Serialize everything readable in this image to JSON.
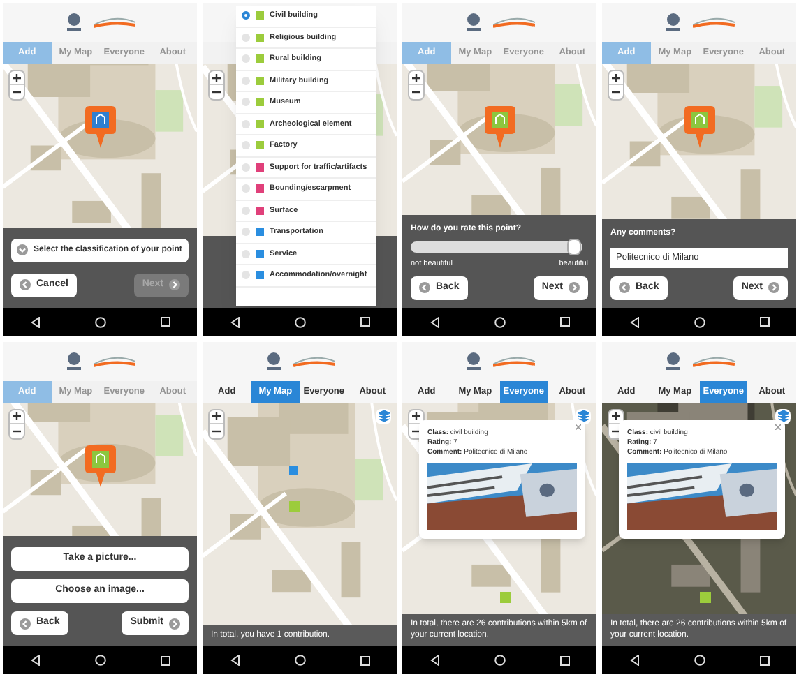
{
  "phones": [
    {
      "tabs_disabled": true,
      "tabs": [
        {
          "label": "Add",
          "selected": true
        },
        {
          "label": "My Map",
          "selected": false
        },
        {
          "label": "Everyone",
          "selected": false
        },
        {
          "label": "About",
          "selected": false
        }
      ],
      "map": {
        "kind": "street",
        "layers": false,
        "marker": {
          "kind": "pin",
          "color": "#2f7fd0"
        }
      },
      "panel": {
        "kind": "classification",
        "select": "Select the classification of your point",
        "buttons": [
          {
            "label": "Cancel",
            "kind": "back",
            "disabled": false
          },
          {
            "label": "Next",
            "kind": "forward",
            "disabled": true
          }
        ]
      }
    },
    {
      "tabs_disabled": true,
      "map": {
        "kind": "street",
        "layers": false
      },
      "panel": {
        "kind": "blank"
      },
      "dropdown": {
        "items": [
          {
            "label": "Civil building",
            "selected": true,
            "color": "#9ccc3c"
          },
          {
            "label": "Religious building",
            "selected": false,
            "color": "#9ccc3c"
          },
          {
            "label": "Rural building",
            "selected": false,
            "color": "#9ccc3c"
          },
          {
            "label": "Military building",
            "selected": false,
            "color": "#9ccc3c"
          },
          {
            "label": "Museum",
            "selected": false,
            "color": "#9ccc3c"
          },
          {
            "label": "Archeological element",
            "selected": false,
            "color": "#9ccc3c"
          },
          {
            "label": "Factory",
            "selected": false,
            "color": "#9ccc3c"
          },
          {
            "label": "Support for traffic/artifacts",
            "selected": false,
            "color": "#e0407a"
          },
          {
            "label": "Bounding/escarpment",
            "selected": false,
            "color": "#e0407a"
          },
          {
            "label": "Surface",
            "selected": false,
            "color": "#e0407a"
          },
          {
            "label": "Transportation",
            "selected": false,
            "color": "#2a8ee0"
          },
          {
            "label": "Service",
            "selected": false,
            "color": "#2a8ee0"
          },
          {
            "label": "Accommodation/overnight",
            "selected": false,
            "color": "#2a8ee0"
          }
        ]
      }
    },
    {
      "tabs_disabled": true,
      "tabs": [
        {
          "label": "Add",
          "selected": true
        },
        {
          "label": "My Map",
          "selected": false
        },
        {
          "label": "Everyone",
          "selected": false
        },
        {
          "label": "About",
          "selected": false
        }
      ],
      "map": {
        "kind": "street",
        "layers": false,
        "marker": {
          "kind": "pin",
          "color": "#8cc63f"
        }
      },
      "panel": {
        "kind": "rating",
        "question": "How do you rate this point?",
        "level": 0.95,
        "low": "not beautiful",
        "high": "beautiful",
        "buttons": [
          {
            "label": "Back",
            "kind": "back",
            "disabled": false
          },
          {
            "label": "Next",
            "kind": "forward",
            "disabled": false
          }
        ]
      }
    },
    {
      "tabs_disabled": true,
      "tabs": [
        {
          "label": "Add",
          "selected": true
        },
        {
          "label": "My Map",
          "selected": false
        },
        {
          "label": "Everyone",
          "selected": false
        },
        {
          "label": "About",
          "selected": false
        }
      ],
      "map": {
        "kind": "street",
        "layers": false,
        "marker": {
          "kind": "pin",
          "color": "#8cc63f"
        }
      },
      "panel": {
        "kind": "comment",
        "question": "Any comments?",
        "value": "Politecnico di Milano",
        "buttons": [
          {
            "label": "Back",
            "kind": "back",
            "disabled": false
          },
          {
            "label": "Next",
            "kind": "forward",
            "disabled": false
          }
        ]
      }
    },
    {
      "tabs_disabled": true,
      "tabs": [
        {
          "label": "Add",
          "selected": true
        },
        {
          "label": "My Map",
          "selected": false
        },
        {
          "label": "Everyone",
          "selected": false
        },
        {
          "label": "About",
          "selected": false
        }
      ],
      "map": {
        "kind": "street",
        "layers": false,
        "marker": {
          "kind": "pin",
          "color": "#8cc63f"
        }
      },
      "panel": {
        "actions": [
          "Take a picture...",
          "Choose an image..."
        ],
        "buttons": [
          {
            "label": "Back",
            "kind": "back",
            "disabled": false
          },
          {
            "label": "Submit",
            "kind": "forward",
            "disabled": false
          }
        ]
      }
    },
    {
      "tabs_disabled": false,
      "tabs": [
        {
          "label": "Add",
          "selected": false
        },
        {
          "label": "My Map",
          "selected": true
        },
        {
          "label": "Everyone",
          "selected": false
        },
        {
          "label": "About",
          "selected": false
        }
      ],
      "map": {
        "kind": "street",
        "layers": true,
        "marker": {
          "kind": "squares"
        }
      },
      "panel": {
        "kind": "summary",
        "text": "In total, you have 1 contribution."
      }
    },
    {
      "tabs_disabled": false,
      "tabs": [
        {
          "label": "Add",
          "selected": false
        },
        {
          "label": "My Map",
          "selected": false
        },
        {
          "label": "Everyone",
          "selected": true
        },
        {
          "label": "About",
          "selected": false
        }
      ],
      "map": {
        "kind": "street",
        "layers": true,
        "marker": {
          "kind": "single"
        }
      },
      "popup": {
        "lines": [
          "**Class:** civil building",
          "**Rating:** 7",
          "**Comment:** Politecnico di Milano"
        ]
      },
      "panel": {
        "kind": "summary",
        "text": "In total, there are 26 contributions within 5km of your current location."
      }
    },
    {
      "tabs_disabled": false,
      "tabs": [
        {
          "label": "Add",
          "selected": false
        },
        {
          "label": "My Map",
          "selected": false
        },
        {
          "label": "Everyone",
          "selected": true
        },
        {
          "label": "About",
          "selected": false
        }
      ],
      "map": {
        "kind": "satellite",
        "layers": true,
        "marker": {
          "kind": "single"
        }
      },
      "popup": {
        "lines": [
          "**Class:** civil building",
          "**Rating:** 7",
          "**Comment:** Politecnico di Milano"
        ]
      },
      "panel": {
        "kind": "summary",
        "text": "In total, there are 26 contributions within 5km of your current location."
      }
    }
  ]
}
